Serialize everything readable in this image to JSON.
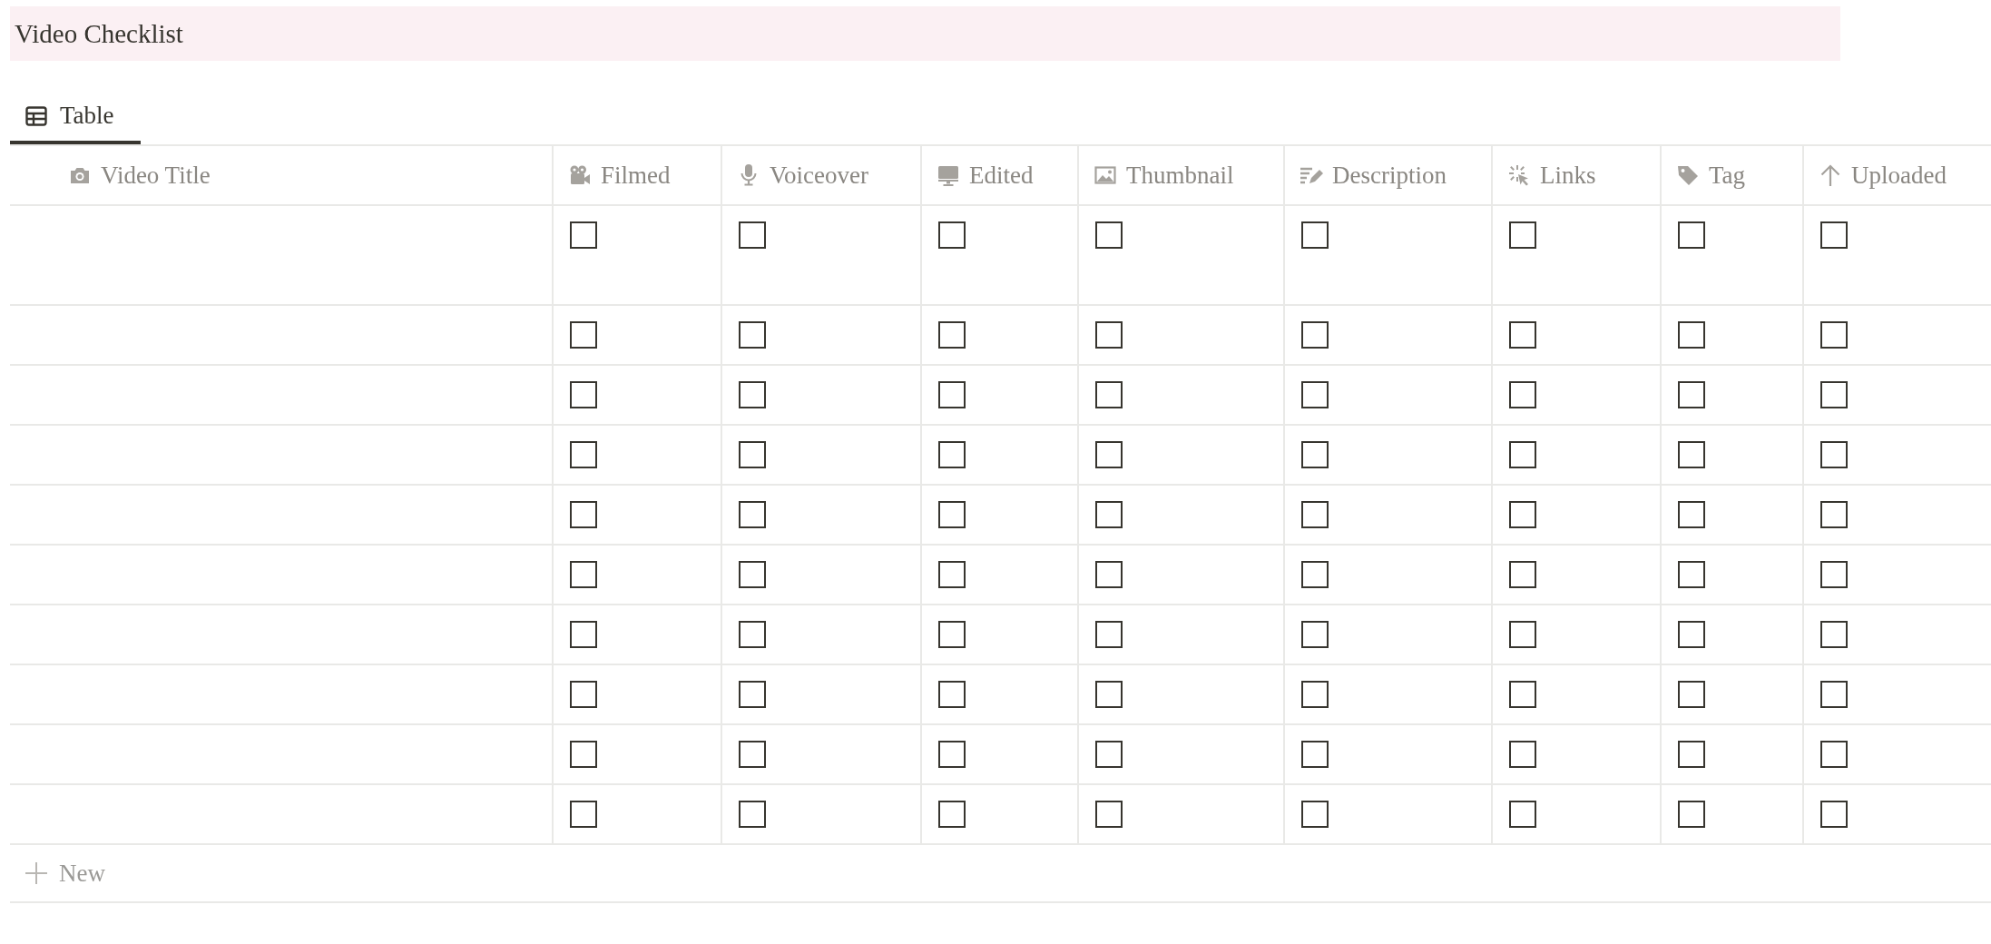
{
  "title": "Video Checklist",
  "tabs": [
    {
      "label": "Table",
      "selected": true
    }
  ],
  "table": {
    "columns": [
      "Video Title",
      "Filmed",
      "Voiceover",
      "Edited",
      "Thumbnail",
      "Description",
      "Links",
      "Tag",
      "Uploaded"
    ],
    "rows": [
      {
        "checks": [
          false,
          false,
          false,
          false,
          false,
          false,
          false,
          false
        ]
      },
      {
        "checks": [
          false,
          false,
          false,
          false,
          false,
          false,
          false,
          false
        ]
      },
      {
        "checks": [
          false,
          false,
          false,
          false,
          false,
          false,
          false,
          false
        ]
      },
      {
        "checks": [
          false,
          false,
          false,
          false,
          false,
          false,
          false,
          false
        ]
      },
      {
        "checks": [
          false,
          false,
          false,
          false,
          false,
          false,
          false,
          false
        ]
      },
      {
        "checks": [
          false,
          false,
          false,
          false,
          false,
          false,
          false,
          false
        ]
      },
      {
        "checks": [
          false,
          false,
          false,
          false,
          false,
          false,
          false,
          false
        ]
      },
      {
        "checks": [
          false,
          false,
          false,
          false,
          false,
          false,
          false,
          false
        ]
      },
      {
        "checks": [
          false,
          false,
          false,
          false,
          false,
          false,
          false,
          false
        ]
      },
      {
        "checks": [
          false,
          false,
          false,
          false,
          false,
          false,
          false,
          false
        ]
      }
    ],
    "new_row": "New"
  }
}
